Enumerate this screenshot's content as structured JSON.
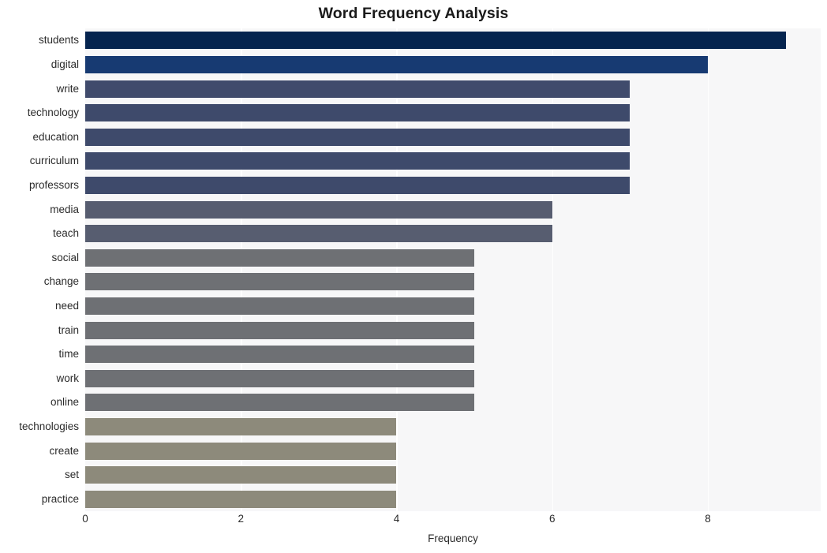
{
  "chart_data": {
    "type": "bar",
    "orientation": "horizontal",
    "title": "Word Frequency Analysis",
    "xlabel": "Frequency",
    "ylabel": "",
    "xlim": [
      0,
      9.45
    ],
    "xticks": [
      0,
      2,
      4,
      6,
      8
    ],
    "grid": true,
    "legend": null,
    "categories": [
      "students",
      "digital",
      "write",
      "technology",
      "education",
      "curriculum",
      "professors",
      "media",
      "teach",
      "social",
      "change",
      "need",
      "train",
      "time",
      "work",
      "online",
      "technologies",
      "create",
      "set",
      "practice"
    ],
    "values": [
      9,
      8,
      7,
      7,
      7,
      7,
      7,
      6,
      6,
      5,
      5,
      5,
      5,
      5,
      5,
      5,
      4,
      4,
      4,
      4
    ],
    "bar_colors": [
      "#05244f",
      "#173a72",
      "#404b6c",
      "#3e4a6b",
      "#3e4a6b",
      "#3e4a6b",
      "#3e4a6b",
      "#575d70",
      "#575d70",
      "#6e7074",
      "#6e7074",
      "#6e7074",
      "#6e7074",
      "#6e7074",
      "#6e7074",
      "#6e7074",
      "#8d8a7b",
      "#8d8a7b",
      "#8d8a7b",
      "#8d8a7b"
    ]
  },
  "style": {
    "plot_background": "#f7f7f8",
    "gridline_color": "#ffffff",
    "figure_background": "#ffffff",
    "text_color": "#2b2b2b",
    "title_color": "#1a1a1a"
  }
}
